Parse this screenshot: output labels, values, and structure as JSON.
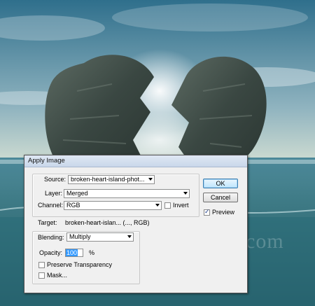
{
  "dialog": {
    "title": "Apply Image",
    "source_label": "Source:",
    "source_value": "broken-heart-island-phot...",
    "layer_label": "Layer:",
    "layer_value": "Merged",
    "channel_label": "Channel:",
    "channel_value": "RGB",
    "invert_label": "Invert",
    "invert_checked": false,
    "target_label": "Target:",
    "target_value": "broken-heart-islan... (..., RGB)",
    "blending_label": "Blending:",
    "blending_value": "Multiply",
    "opacity_label": "Opacity:",
    "opacity_value": "100",
    "opacity_unit": "%",
    "preserve_transparency_label": "Preserve Transparency",
    "preserve_transparency_checked": false,
    "mask_label": "Mask...",
    "mask_checked": false,
    "ok_label": "OK",
    "cancel_label": "Cancel",
    "preview_label": "Preview",
    "preview_checked": true
  },
  "background": {
    "watermark": "www.psd-dude.com"
  }
}
